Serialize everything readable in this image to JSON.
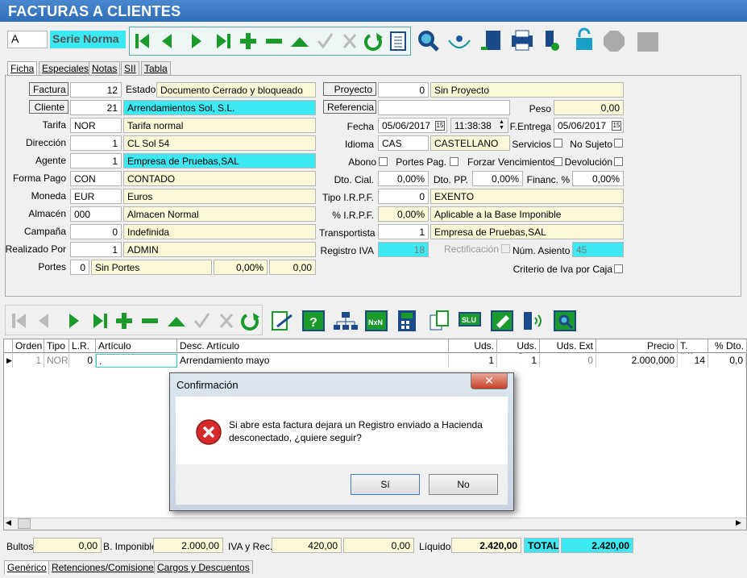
{
  "window": {
    "title": "FACTURAS A CLIENTES"
  },
  "series": {
    "code": "A",
    "label": "Serie Norma"
  },
  "tabs": [
    "Ficha",
    "Especiales",
    "Notas",
    "SII",
    "Tabla"
  ],
  "form": {
    "factura_label": "Factura",
    "factura": "12",
    "estado_label": "Estado",
    "estado": "Documento Cerrado y bloqueado",
    "cliente_label": "Cliente",
    "cliente": "21",
    "cliente_name": "Arrendamientos Sol, S.L.",
    "tarifa_label": "Tarifa",
    "tarifa": "NOR",
    "tarifa_name": "Tarifa normal",
    "direccion_label": "Dirección",
    "direccion": "1",
    "direccion_name": "CL  Sol 54",
    "agente_label": "Agente",
    "agente": "1",
    "agente_name": "Empresa de Pruebas,SAL",
    "forma_pago_label": "Forma Pago",
    "forma_pago": "CON",
    "forma_pago_name": "CONTADO",
    "moneda_label": "Moneda",
    "moneda": "EUR",
    "moneda_name": "Euros",
    "almacen_label": "Almacén",
    "almacen": "000",
    "almacen_name": "Almacen Normal",
    "campana_label": "Campaña",
    "campana": "0",
    "campana_name": "Indefinida",
    "realizado_label": "Realizado Por",
    "realizado": "1",
    "realizado_name": "ADMIN",
    "portes_label": "Portes",
    "portes": "0",
    "portes_name": "Sin Portes",
    "portes_pct": "0,00%",
    "portes_val": "0,00",
    "proyecto_label": "Proyecto",
    "proyecto": "0",
    "proyecto_name": "Sin Proyecto",
    "referencia_label": "Referencia",
    "referencia": "",
    "peso_label": "Peso",
    "peso": "0,00",
    "fecha_label": "Fecha",
    "fecha": "05/06/2017",
    "hora": "11:38:38",
    "fentrega_label": "F.Entrega",
    "fentrega": "05/06/2017",
    "idioma_label": "Idioma",
    "idioma": "CAS",
    "idioma_name": "CASTELLANO",
    "servicios_label": "Servicios",
    "nosujeto_label": "No Sujeto",
    "abono_label": "Abono",
    "portes_pag_label": "Portes Pag.",
    "forzar_label": "Forzar Vencimientos",
    "devolucion_label": "Devolución",
    "dto_cial_label": "Dto. Cial.",
    "dto_cial": "0,00%",
    "dto_pp_label": "Dto. PP.",
    "dto_pp": "0,00%",
    "financ_label": "Financ. %",
    "financ": "0,00%",
    "tipo_irpf_label": "Tipo I.R.P.F.",
    "tipo_irpf": "0",
    "tipo_irpf_name": "EXENTO",
    "pct_irpf_label": "% I.R.P.F.",
    "pct_irpf": "0,00%",
    "pct_irpf_name": "Aplicable a la Base Imponible",
    "transportista_label": "Transportista",
    "transportista": "1",
    "transportista_name": "Empresa de Pruebas,SAL",
    "registro_iva_label": "Registro IVA",
    "registro_iva": "18",
    "rectificacion_label": "Rectificación",
    "num_asiento_label": "Núm. Asiento",
    "num_asiento": "45",
    "criterio_label": "Criterio de Iva por Caja"
  },
  "grid": {
    "headers": [
      "Orden",
      "Tipo",
      "L.R.",
      "Artículo",
      "Desc. Artículo",
      "Uds.",
      "Uds. Sec.",
      "Uds. Ext",
      "Precio",
      "T. IVA",
      "% Dto."
    ],
    "rows": [
      {
        "orden": "1",
        "tipo": "NOR",
        "lr": "0",
        "articulo": ".",
        "desc": "Arrendamiento mayo",
        "uds": "1",
        "uds_sec": "1",
        "uds_ext": "0",
        "precio": "2.000,000",
        "tiva": "14",
        "dto": "0,0"
      }
    ]
  },
  "dialog": {
    "title": "Confirmación",
    "message_line1": "Si abre esta factura dejara un Registro enviado a Hacienda",
    "message_line2": "desconectado, ¿quiere seguir?",
    "yes": "Sí",
    "no": "No"
  },
  "totals": {
    "bultos_label": "Bultos",
    "bultos": "0,00",
    "base_label": "B. Imponible",
    "base": "2.000,00",
    "iva_label": "IVA y Rec.",
    "iva": "420,00",
    "rec": "0,00",
    "liquido_label": "Líquido",
    "liquido": "2.420,00",
    "total_label": "TOTAL",
    "total": "2.420,00"
  },
  "bottom_tabs": [
    "Genérico",
    "Retenciones/Comisiones",
    "Cargos y Descuentos"
  ],
  "colors": {
    "title": "#2f6db5",
    "cyan": "#3ce8f2",
    "yellow": "#fbf8d8",
    "green": "#1a9a2a",
    "blue": "#2a6fd6"
  }
}
